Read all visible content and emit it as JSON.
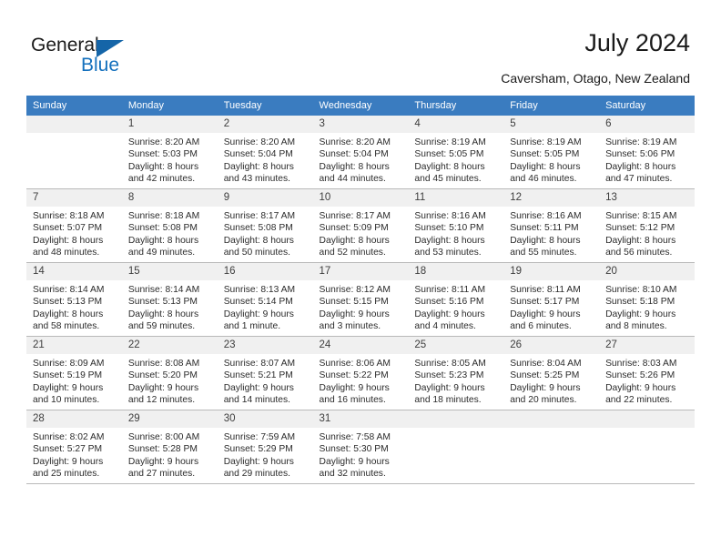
{
  "logo": {
    "word_one": "General",
    "word_two": "Blue",
    "triangle_color": "#1565a8",
    "blue_color": "#1470bd"
  },
  "header": {
    "title": "July 2024",
    "subtitle": "Caversham, Otago, New Zealand"
  },
  "calendar": {
    "header_bg": "#3a7cc0",
    "daynum_bg": "#f0f0f0",
    "weekday_headers": [
      "Sunday",
      "Monday",
      "Tuesday",
      "Wednesday",
      "Thursday",
      "Friday",
      "Saturday"
    ],
    "weeks": [
      [
        {
          "day": "",
          "sunrise": "",
          "sunset": "",
          "daylight_a": "",
          "daylight_b": ""
        },
        {
          "day": "1",
          "sunrise": "Sunrise: 8:20 AM",
          "sunset": "Sunset: 5:03 PM",
          "daylight_a": "Daylight: 8 hours",
          "daylight_b": "and 42 minutes."
        },
        {
          "day": "2",
          "sunrise": "Sunrise: 8:20 AM",
          "sunset": "Sunset: 5:04 PM",
          "daylight_a": "Daylight: 8 hours",
          "daylight_b": "and 43 minutes."
        },
        {
          "day": "3",
          "sunrise": "Sunrise: 8:20 AM",
          "sunset": "Sunset: 5:04 PM",
          "daylight_a": "Daylight: 8 hours",
          "daylight_b": "and 44 minutes."
        },
        {
          "day": "4",
          "sunrise": "Sunrise: 8:19 AM",
          "sunset": "Sunset: 5:05 PM",
          "daylight_a": "Daylight: 8 hours",
          "daylight_b": "and 45 minutes."
        },
        {
          "day": "5",
          "sunrise": "Sunrise: 8:19 AM",
          "sunset": "Sunset: 5:05 PM",
          "daylight_a": "Daylight: 8 hours",
          "daylight_b": "and 46 minutes."
        },
        {
          "day": "6",
          "sunrise": "Sunrise: 8:19 AM",
          "sunset": "Sunset: 5:06 PM",
          "daylight_a": "Daylight: 8 hours",
          "daylight_b": "and 47 minutes."
        }
      ],
      [
        {
          "day": "7",
          "sunrise": "Sunrise: 8:18 AM",
          "sunset": "Sunset: 5:07 PM",
          "daylight_a": "Daylight: 8 hours",
          "daylight_b": "and 48 minutes."
        },
        {
          "day": "8",
          "sunrise": "Sunrise: 8:18 AM",
          "sunset": "Sunset: 5:08 PM",
          "daylight_a": "Daylight: 8 hours",
          "daylight_b": "and 49 minutes."
        },
        {
          "day": "9",
          "sunrise": "Sunrise: 8:17 AM",
          "sunset": "Sunset: 5:08 PM",
          "daylight_a": "Daylight: 8 hours",
          "daylight_b": "and 50 minutes."
        },
        {
          "day": "10",
          "sunrise": "Sunrise: 8:17 AM",
          "sunset": "Sunset: 5:09 PM",
          "daylight_a": "Daylight: 8 hours",
          "daylight_b": "and 52 minutes."
        },
        {
          "day": "11",
          "sunrise": "Sunrise: 8:16 AM",
          "sunset": "Sunset: 5:10 PM",
          "daylight_a": "Daylight: 8 hours",
          "daylight_b": "and 53 minutes."
        },
        {
          "day": "12",
          "sunrise": "Sunrise: 8:16 AM",
          "sunset": "Sunset: 5:11 PM",
          "daylight_a": "Daylight: 8 hours",
          "daylight_b": "and 55 minutes."
        },
        {
          "day": "13",
          "sunrise": "Sunrise: 8:15 AM",
          "sunset": "Sunset: 5:12 PM",
          "daylight_a": "Daylight: 8 hours",
          "daylight_b": "and 56 minutes."
        }
      ],
      [
        {
          "day": "14",
          "sunrise": "Sunrise: 8:14 AM",
          "sunset": "Sunset: 5:13 PM",
          "daylight_a": "Daylight: 8 hours",
          "daylight_b": "and 58 minutes."
        },
        {
          "day": "15",
          "sunrise": "Sunrise: 8:14 AM",
          "sunset": "Sunset: 5:13 PM",
          "daylight_a": "Daylight: 8 hours",
          "daylight_b": "and 59 minutes."
        },
        {
          "day": "16",
          "sunrise": "Sunrise: 8:13 AM",
          "sunset": "Sunset: 5:14 PM",
          "daylight_a": "Daylight: 9 hours",
          "daylight_b": "and 1 minute."
        },
        {
          "day": "17",
          "sunrise": "Sunrise: 8:12 AM",
          "sunset": "Sunset: 5:15 PM",
          "daylight_a": "Daylight: 9 hours",
          "daylight_b": "and 3 minutes."
        },
        {
          "day": "18",
          "sunrise": "Sunrise: 8:11 AM",
          "sunset": "Sunset: 5:16 PM",
          "daylight_a": "Daylight: 9 hours",
          "daylight_b": "and 4 minutes."
        },
        {
          "day": "19",
          "sunrise": "Sunrise: 8:11 AM",
          "sunset": "Sunset: 5:17 PM",
          "daylight_a": "Daylight: 9 hours",
          "daylight_b": "and 6 minutes."
        },
        {
          "day": "20",
          "sunrise": "Sunrise: 8:10 AM",
          "sunset": "Sunset: 5:18 PM",
          "daylight_a": "Daylight: 9 hours",
          "daylight_b": "and 8 minutes."
        }
      ],
      [
        {
          "day": "21",
          "sunrise": "Sunrise: 8:09 AM",
          "sunset": "Sunset: 5:19 PM",
          "daylight_a": "Daylight: 9 hours",
          "daylight_b": "and 10 minutes."
        },
        {
          "day": "22",
          "sunrise": "Sunrise: 8:08 AM",
          "sunset": "Sunset: 5:20 PM",
          "daylight_a": "Daylight: 9 hours",
          "daylight_b": "and 12 minutes."
        },
        {
          "day": "23",
          "sunrise": "Sunrise: 8:07 AM",
          "sunset": "Sunset: 5:21 PM",
          "daylight_a": "Daylight: 9 hours",
          "daylight_b": "and 14 minutes."
        },
        {
          "day": "24",
          "sunrise": "Sunrise: 8:06 AM",
          "sunset": "Sunset: 5:22 PM",
          "daylight_a": "Daylight: 9 hours",
          "daylight_b": "and 16 minutes."
        },
        {
          "day": "25",
          "sunrise": "Sunrise: 8:05 AM",
          "sunset": "Sunset: 5:23 PM",
          "daylight_a": "Daylight: 9 hours",
          "daylight_b": "and 18 minutes."
        },
        {
          "day": "26",
          "sunrise": "Sunrise: 8:04 AM",
          "sunset": "Sunset: 5:25 PM",
          "daylight_a": "Daylight: 9 hours",
          "daylight_b": "and 20 minutes."
        },
        {
          "day": "27",
          "sunrise": "Sunrise: 8:03 AM",
          "sunset": "Sunset: 5:26 PM",
          "daylight_a": "Daylight: 9 hours",
          "daylight_b": "and 22 minutes."
        }
      ],
      [
        {
          "day": "28",
          "sunrise": "Sunrise: 8:02 AM",
          "sunset": "Sunset: 5:27 PM",
          "daylight_a": "Daylight: 9 hours",
          "daylight_b": "and 25 minutes."
        },
        {
          "day": "29",
          "sunrise": "Sunrise: 8:00 AM",
          "sunset": "Sunset: 5:28 PM",
          "daylight_a": "Daylight: 9 hours",
          "daylight_b": "and 27 minutes."
        },
        {
          "day": "30",
          "sunrise": "Sunrise: 7:59 AM",
          "sunset": "Sunset: 5:29 PM",
          "daylight_a": "Daylight: 9 hours",
          "daylight_b": "and 29 minutes."
        },
        {
          "day": "31",
          "sunrise": "Sunrise: 7:58 AM",
          "sunset": "Sunset: 5:30 PM",
          "daylight_a": "Daylight: 9 hours",
          "daylight_b": "and 32 minutes."
        },
        {
          "day": "",
          "sunrise": "",
          "sunset": "",
          "daylight_a": "",
          "daylight_b": ""
        },
        {
          "day": "",
          "sunrise": "",
          "sunset": "",
          "daylight_a": "",
          "daylight_b": ""
        },
        {
          "day": "",
          "sunrise": "",
          "sunset": "",
          "daylight_a": "",
          "daylight_b": ""
        }
      ]
    ]
  }
}
